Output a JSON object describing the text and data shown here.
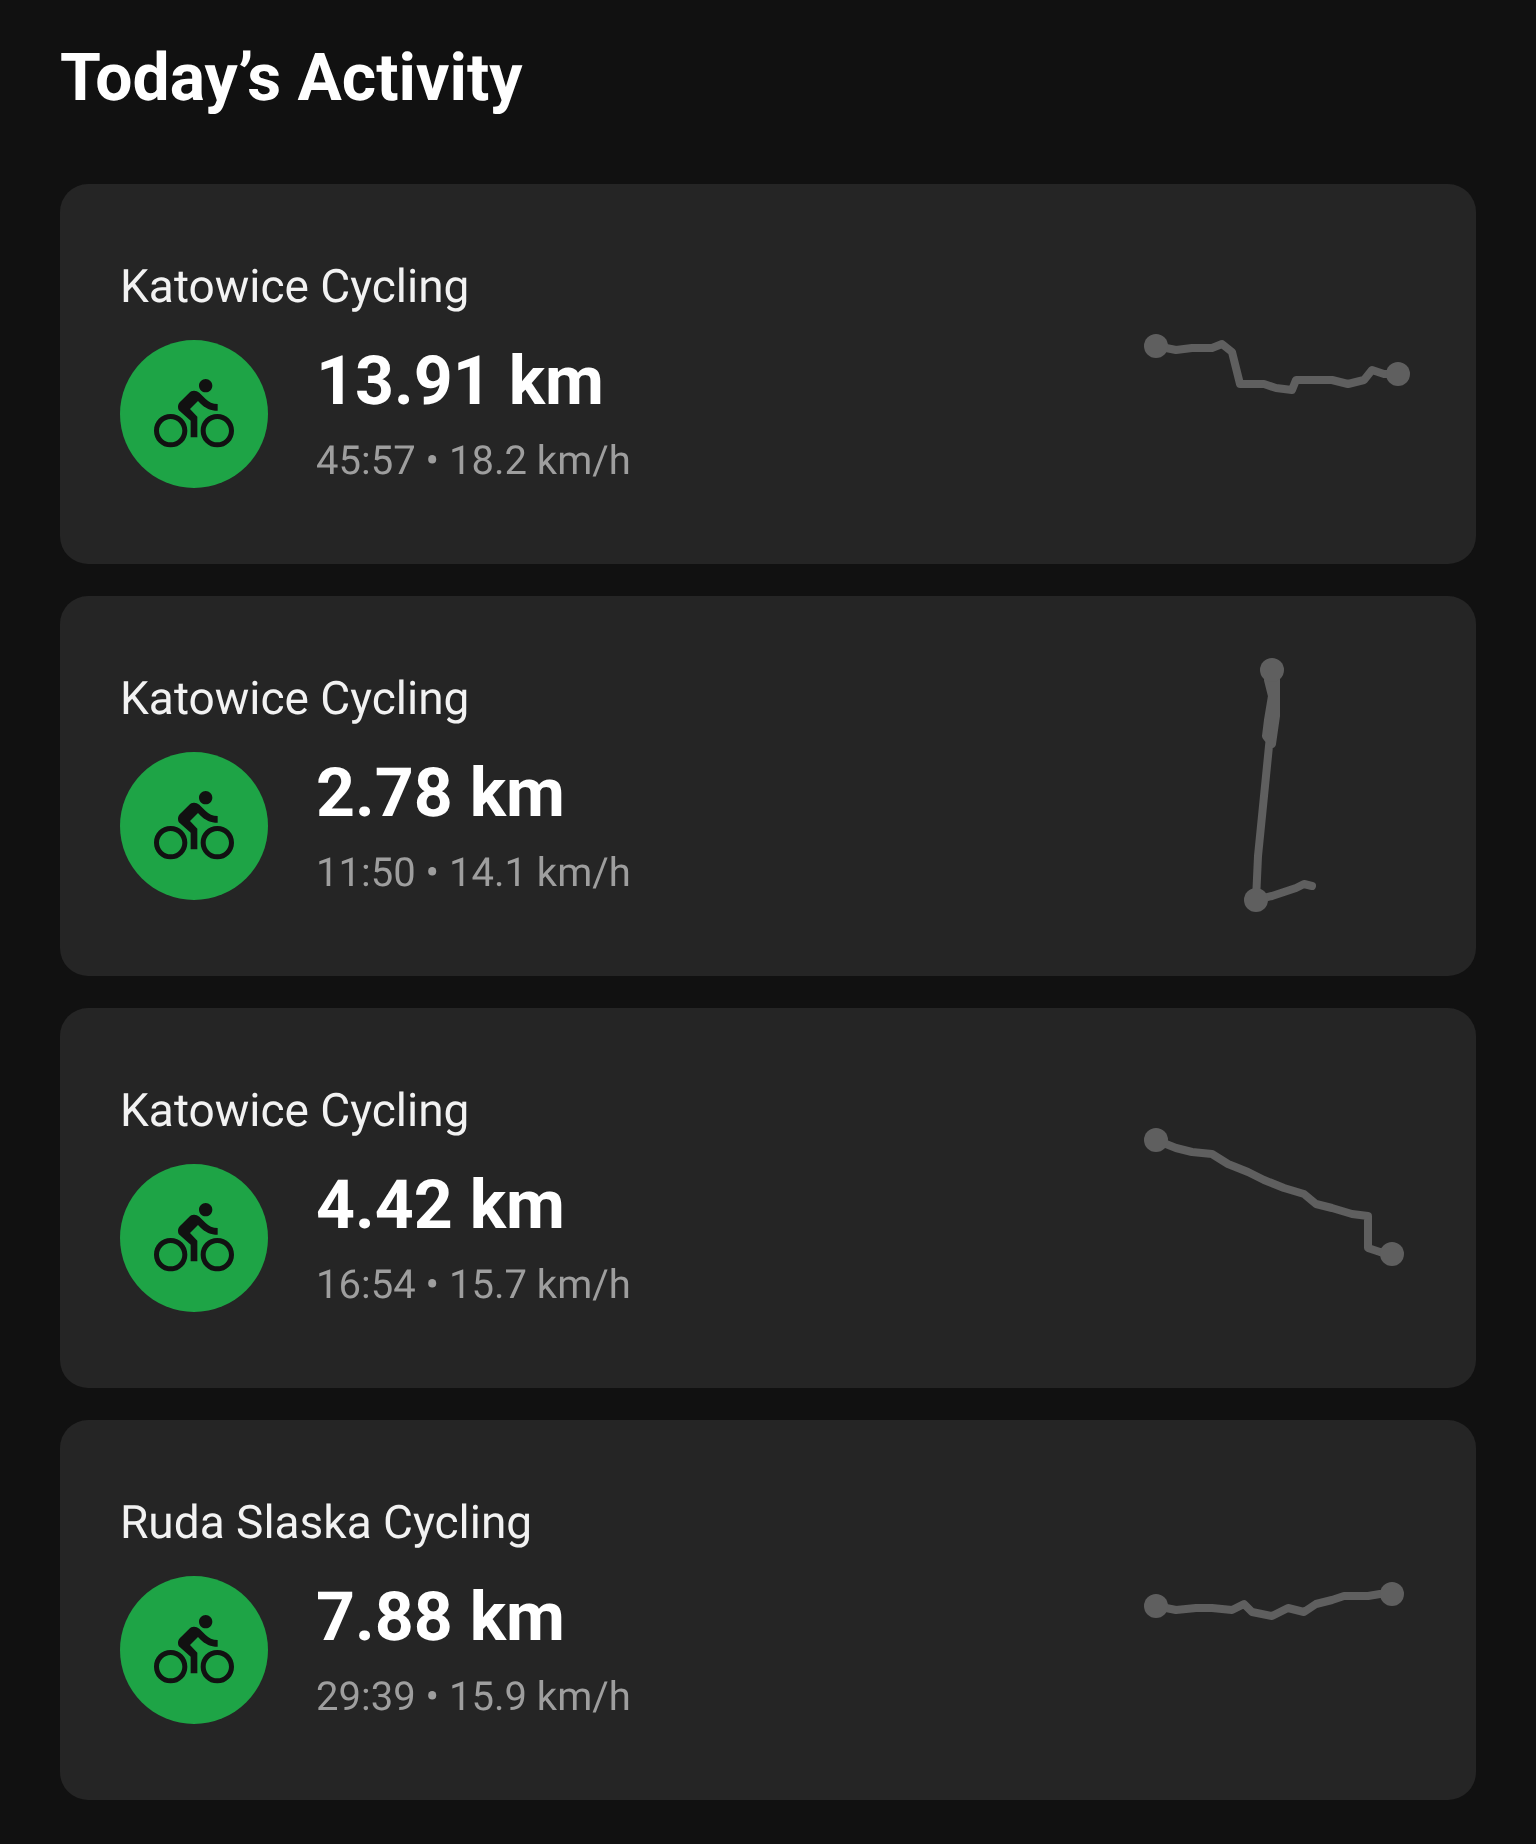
{
  "title": "Today’s Activity",
  "activities": [
    {
      "name": "Katowice Cycling",
      "distance": "13.91 km",
      "stats": "45:57 • 18.2 km/h"
    },
    {
      "name": "Katowice Cycling",
      "distance": "2.78 km",
      "stats": "11:50 • 14.1 km/h"
    },
    {
      "name": "Katowice Cycling",
      "distance": "4.42 km",
      "stats": "16:54 • 15.7 km/h"
    },
    {
      "name": "Ruda Slaska Cycling",
      "distance": "7.88 km",
      "stats": "29:39 • 15.9 km/h"
    }
  ]
}
